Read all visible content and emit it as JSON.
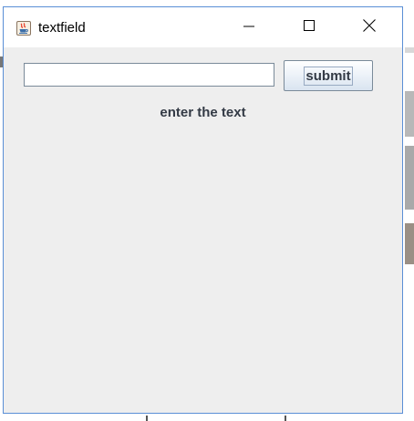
{
  "window": {
    "title": "textfield",
    "title_icon": "java-coffee-icon",
    "controls": {
      "minimize_icon": "minimize-icon",
      "maximize_icon": "maximize-icon",
      "close_icon": "close-icon"
    }
  },
  "form": {
    "text_field_value": "",
    "submit_label": "submit",
    "info_label": "enter the text"
  },
  "colors": {
    "window_border": "#5a8fd6",
    "content_bg": "#eeeeee",
    "label_text": "#333a45"
  }
}
